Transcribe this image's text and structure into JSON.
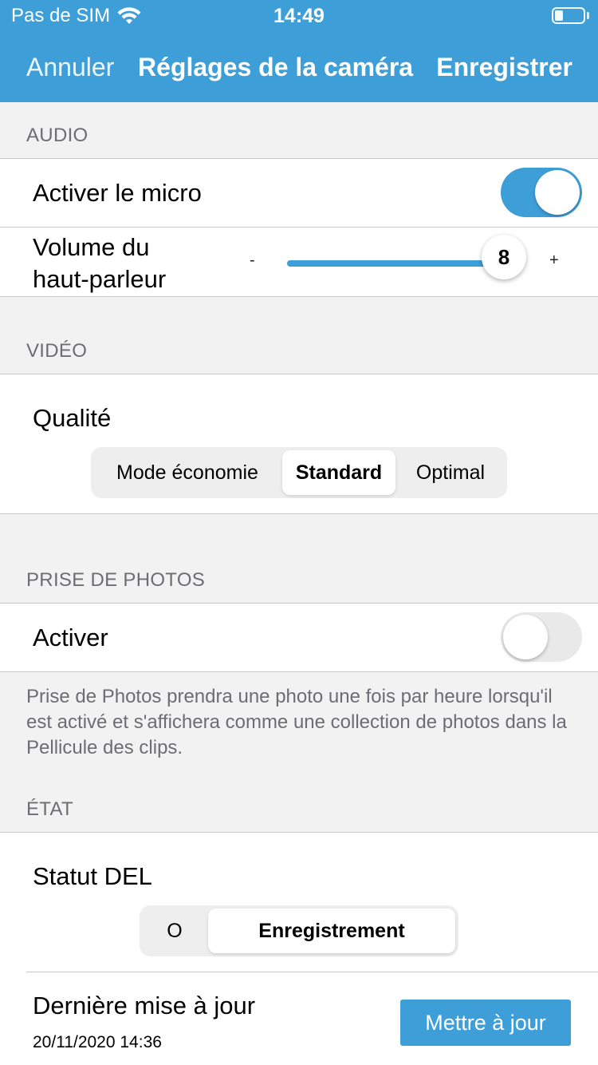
{
  "status_bar": {
    "carrier": "Pas de SIM",
    "time": "14:49",
    "battery_level": 0.3
  },
  "nav": {
    "cancel": "Annuler",
    "title": "Réglages de la caméra",
    "save": "Enregistrer"
  },
  "audio": {
    "header": "AUDIO",
    "mic_label": "Activer le micro",
    "mic_enabled": true,
    "volume_label_line1": "Volume du",
    "volume_label_line2": "haut-parleur",
    "volume_minus": "-",
    "volume_plus": "+",
    "volume_value": "8"
  },
  "video": {
    "header": "VIDÉO",
    "quality_label": "Qualité",
    "quality_options": [
      "Mode économie",
      "Standard",
      "Optimal"
    ],
    "quality_selected": "Standard"
  },
  "photos": {
    "header": "PRISE DE PHOTOS",
    "enable_label": "Activer",
    "enabled": false,
    "note": "Prise de Photos prendra une photo une fois par heure lorsqu'il est activé et s'affichera comme une collection de photos dans la Pellicule des clips."
  },
  "state": {
    "header": "ÉTAT",
    "led_label": "Statut DEL",
    "led_options": [
      "O",
      "Enregistrement"
    ],
    "led_selected": "Enregistrement",
    "last_update_label": "Dernière mise à jour",
    "last_update_date": "20/11/2020 14:36",
    "update_button": "Mettre à jour"
  },
  "colors": {
    "accent": "#3e9fd8",
    "background": "#f2f2f2",
    "section_text": "#6d6d72"
  }
}
